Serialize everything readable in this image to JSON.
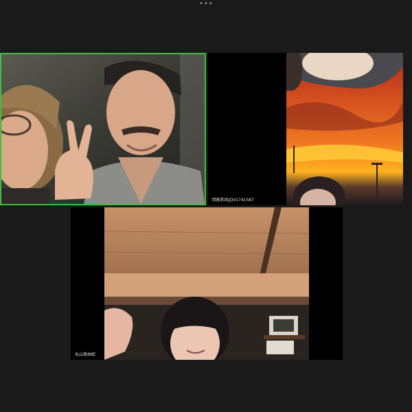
{
  "header": {
    "menu_icon": "more-horizontal-icon",
    "menu_label": "•••"
  },
  "participants": [
    {
      "id": "p1",
      "name": "",
      "active_speaker": true,
      "accent": "#3fbf3f"
    },
    {
      "id": "p2",
      "name": "岡能和共JD01741587"
    },
    {
      "id": "p3",
      "name": "丸山美由紀"
    }
  ],
  "colors": {
    "background": "#1a1a1a",
    "tile": "#000000",
    "label": "#e0e0e0"
  }
}
